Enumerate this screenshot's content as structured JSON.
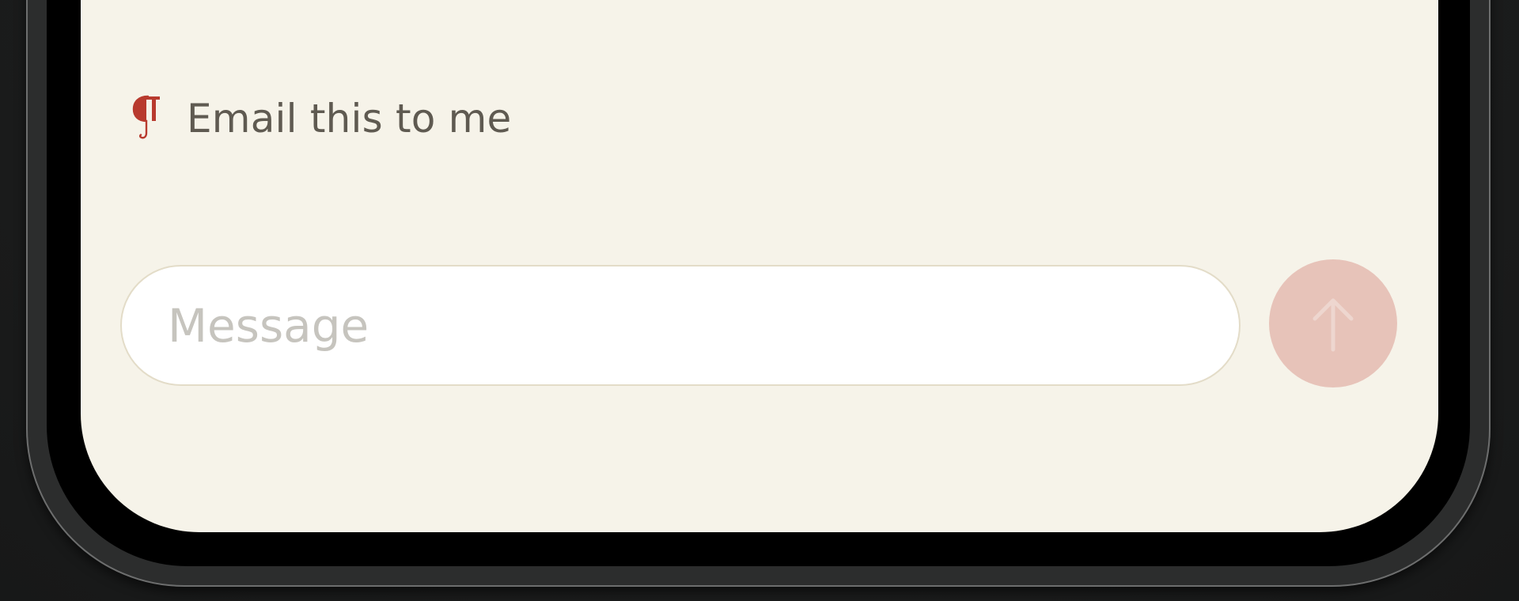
{
  "suggestion": {
    "icon": "pilcrow-icon",
    "label": "Email this to me",
    "icon_color": "#b83a2e"
  },
  "composer": {
    "placeholder": "Message",
    "value": "",
    "send_icon": "arrow-up-icon",
    "send_button_color": "#e7c3b9"
  },
  "colors": {
    "screen_background": "#f6f3e9",
    "device_frame": "#2c2d2d"
  }
}
